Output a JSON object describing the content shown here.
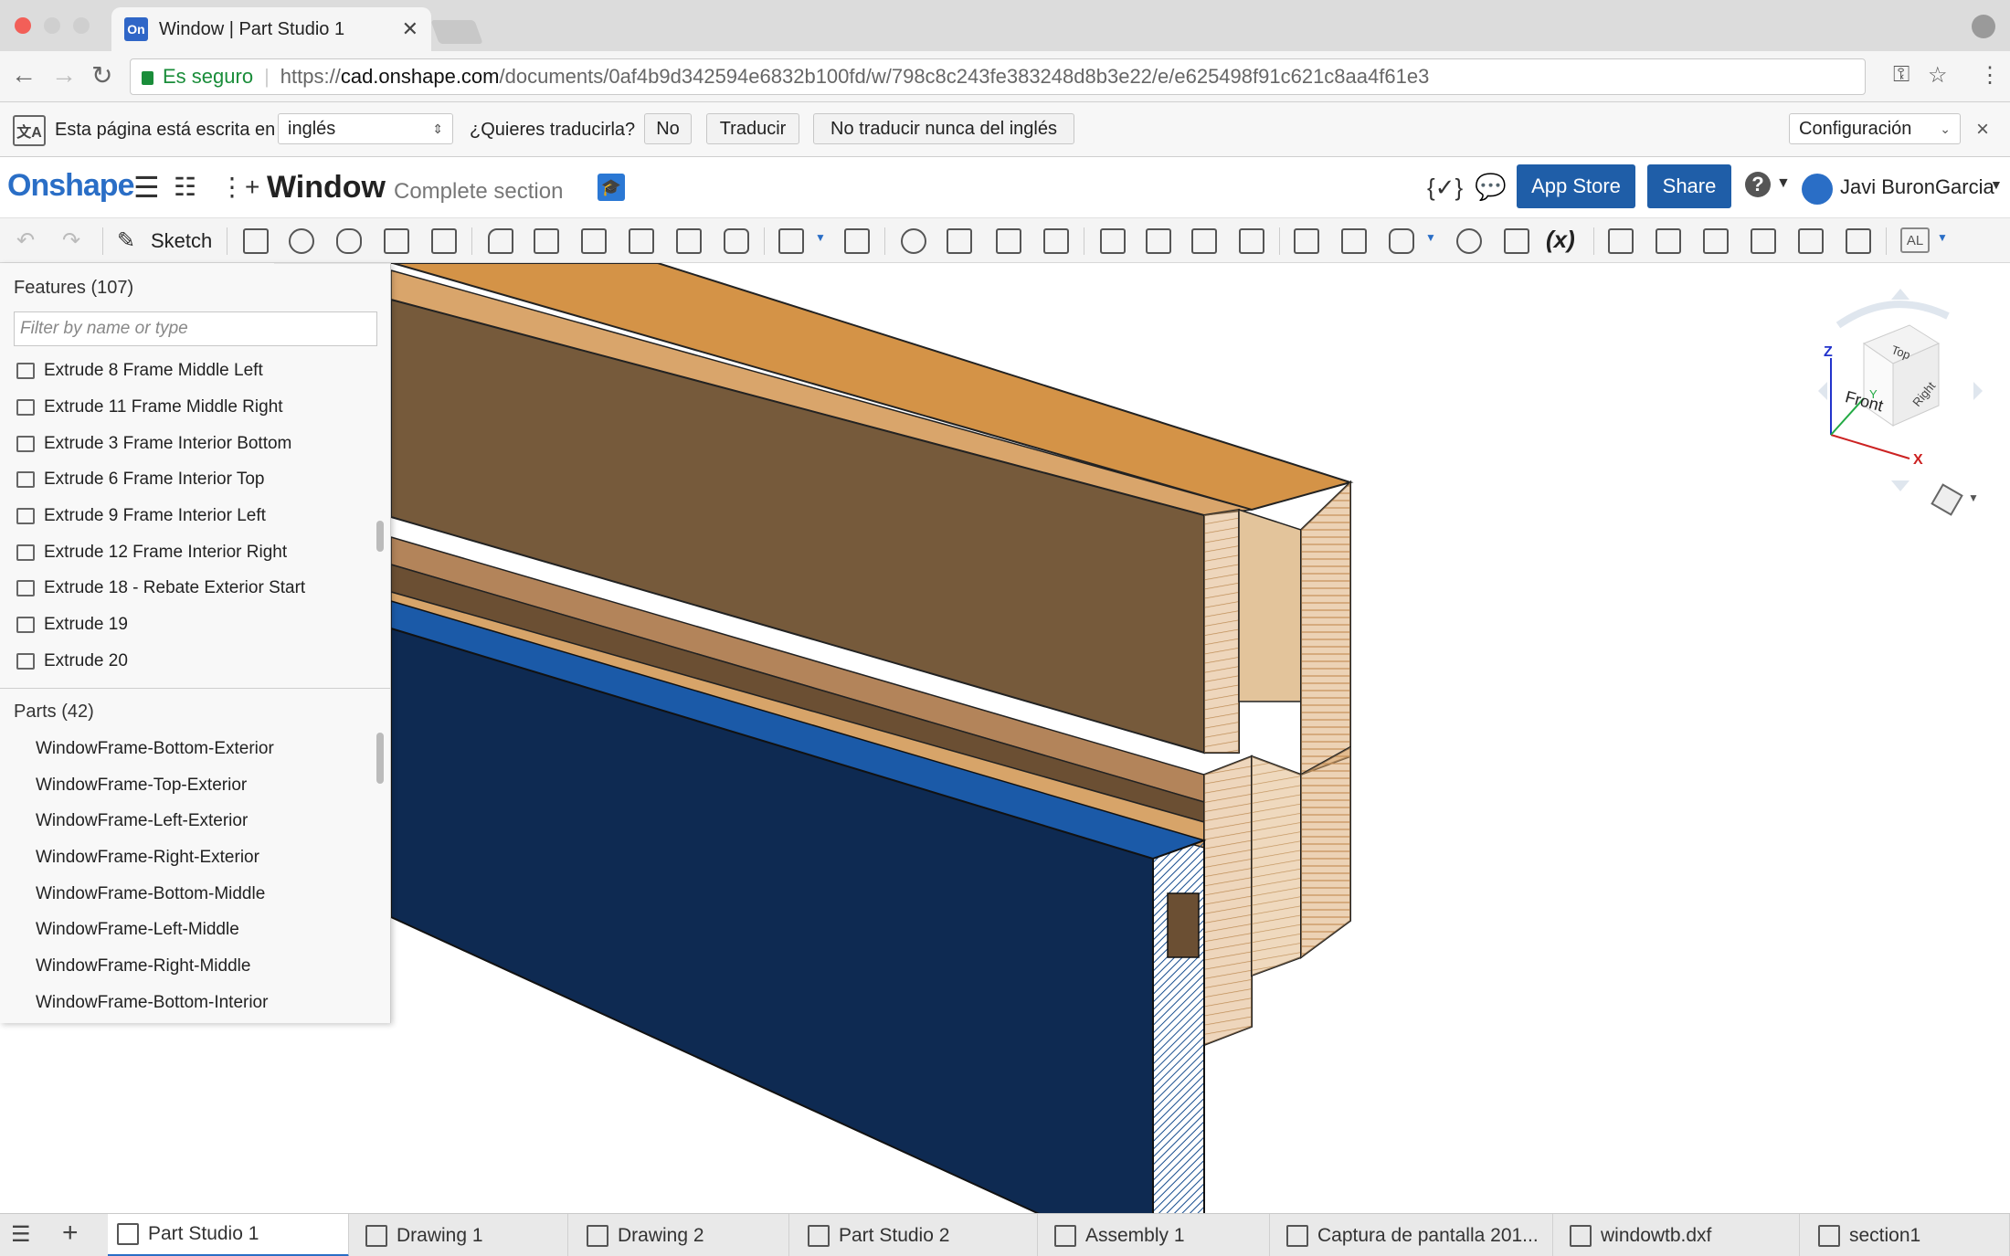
{
  "browser": {
    "tab_title": "Window | Part Studio 1",
    "favicon_text": "On",
    "secure_label": "Es seguro",
    "url_scheme": "https://",
    "url_host": "cad.onshape.com",
    "url_path": "/documents/0af4b9d342594e6832b100fd/w/798c8c243fe383248d8b3e22/e/e625498f91c621c8aa4f61e3"
  },
  "translate_bar": {
    "message": "Esta página está escrita en",
    "language": "inglés",
    "question": "¿Quieres traducirla?",
    "no_label": "No",
    "translate_label": "Traducir",
    "never_label": "No traducir nunca del inglés",
    "config_label": "Configuración",
    "close": "×"
  },
  "header": {
    "logo": "Onshape",
    "doc_title": "Window",
    "doc_subtitle": "Complete section",
    "app_store_label": "App Store",
    "share_label": "Share",
    "help_label": "?",
    "user_name": "Javi BuronGarcia"
  },
  "toolbar": {
    "sketch_label": "Sketch",
    "variable_label": "(x)",
    "al_label": "AL"
  },
  "feature_panel": {
    "features_header": "Features (107)",
    "filter_placeholder": "Filter by name or type",
    "features": [
      "Extrude 8 Frame Middle Left",
      "Extrude 11 Frame Middle Right",
      "Extrude 3 Frame Interior Bottom",
      "Extrude 6 Frame Interior Top",
      "Extrude 9 Frame Interior Left",
      "Extrude 12 Frame Interior Right",
      "Extrude 18 - Rebate Exterior Start",
      "Extrude 19",
      "Extrude 20"
    ],
    "parts_header": "Parts (42)",
    "parts": [
      "WindowFrame-Bottom-Exterior",
      "WindowFrame-Top-Exterior",
      "WindowFrame-Left-Exterior",
      "WindowFrame-Right-Exterior",
      "WindowFrame-Bottom-Middle",
      "WindowFrame-Left-Middle",
      "WindowFrame-Right-Middle",
      "WindowFrame-Bottom-Interior"
    ]
  },
  "view_cube": {
    "top": "Top",
    "front": "Front",
    "right": "Right",
    "x": "X",
    "y": "Y",
    "z": "Z"
  },
  "bottom_tabs": [
    {
      "label": "Part Studio 1",
      "active": true
    },
    {
      "label": "Drawing 1"
    },
    {
      "label": "Drawing 2"
    },
    {
      "label": "Part Studio 2"
    },
    {
      "label": "Assembly 1"
    },
    {
      "label": "Captura de pantalla 201..."
    },
    {
      "label": "windowtb.dxf"
    },
    {
      "label": "section1"
    }
  ],
  "colors": {
    "brand_blue": "#2a6ec6",
    "button_blue": "#1f5ea8",
    "wood_light": "#d9a56b",
    "wood_dark": "#765a3b",
    "glass_blue": "#0e2a52"
  }
}
